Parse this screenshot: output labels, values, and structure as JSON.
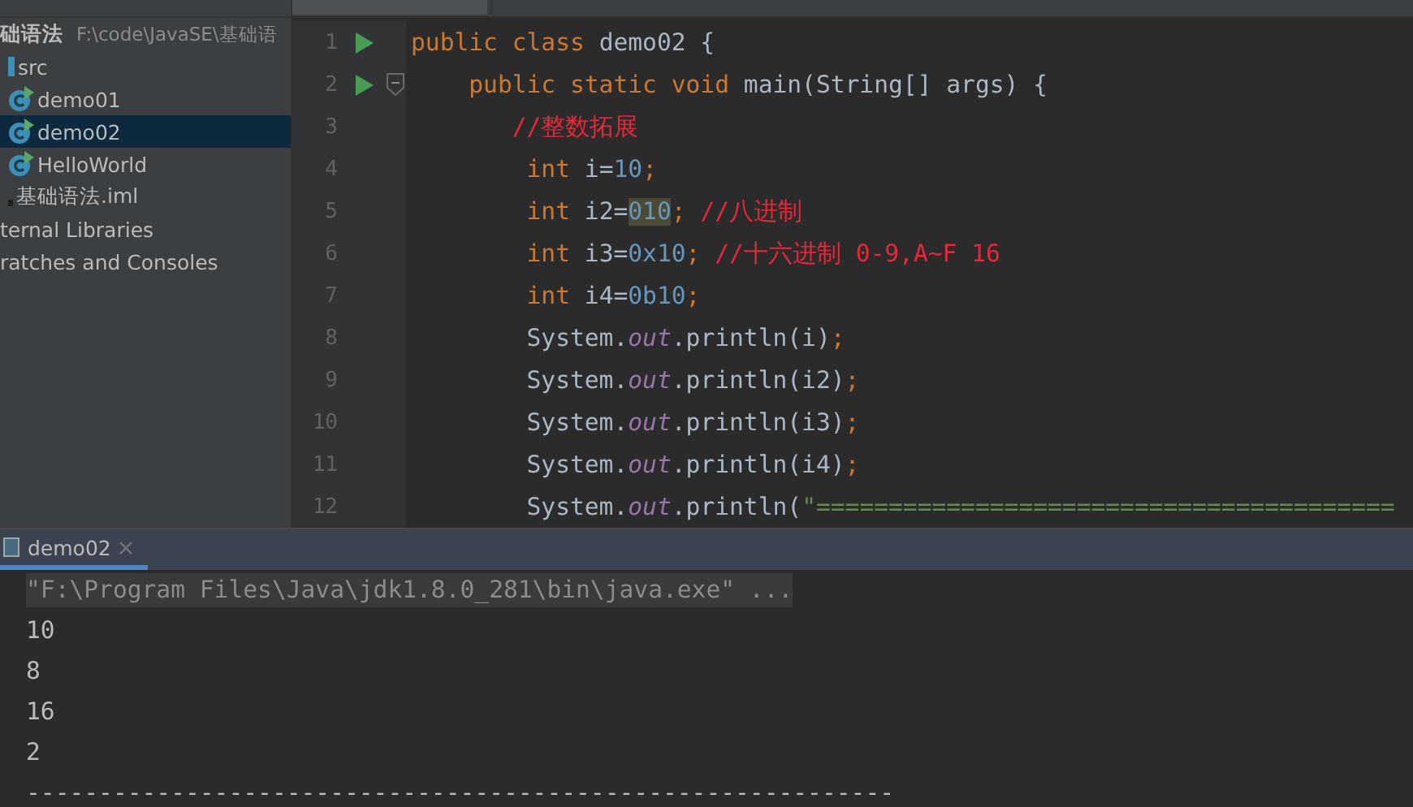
{
  "project_tree": {
    "items": [
      {
        "label": "础语法",
        "kind": "project",
        "path": "F:\\code\\JavaSE\\基础语",
        "selected": false,
        "children": [
          {
            "label": "src",
            "kind": "folder",
            "selected": false,
            "children": [
              {
                "label": "demo01",
                "kind": "class",
                "selected": false
              },
              {
                "label": "demo02",
                "kind": "class",
                "selected": true
              },
              {
                "label": "HelloWorld",
                "kind": "class",
                "selected": false
              }
            ]
          },
          {
            "label": "基础语法.iml",
            "kind": "file",
            "selected": false
          }
        ]
      },
      {
        "label": "ternal Libraries",
        "kind": "group",
        "selected": false
      },
      {
        "label": "ratches and Consoles",
        "kind": "group",
        "selected": false
      }
    ]
  },
  "editor": {
    "lines": [
      {
        "number": "1",
        "run": true,
        "fold": false,
        "tokens": [
          {
            "text": "public class ",
            "kind": "keyword"
          },
          {
            "text": "demo02 {",
            "kind": "plain"
          }
        ]
      },
      {
        "number": "2",
        "run": true,
        "fold": true,
        "tokens": [
          {
            "text": "    public static void ",
            "kind": "keyword"
          },
          {
            "text": "main(String[] args) {",
            "kind": "plain"
          }
        ]
      },
      {
        "number": "3",
        "run": false,
        "fold": false,
        "tokens": [
          {
            "text": "       //整数拓展",
            "kind": "comment"
          }
        ]
      },
      {
        "number": "4",
        "run": false,
        "fold": false,
        "tokens": [
          {
            "text": "        int ",
            "kind": "keyword"
          },
          {
            "text": "i=",
            "kind": "plain"
          },
          {
            "text": "10",
            "kind": "number"
          },
          {
            "text": ";",
            "kind": "keyword"
          }
        ]
      },
      {
        "number": "5",
        "run": false,
        "fold": false,
        "tokens": [
          {
            "text": "        int ",
            "kind": "keyword"
          },
          {
            "text": "i2=",
            "kind": "plain"
          },
          {
            "text": "010",
            "kind": "number",
            "highlighted": true
          },
          {
            "text": "; ",
            "kind": "keyword"
          },
          {
            "text": "//八进制",
            "kind": "comment"
          }
        ]
      },
      {
        "number": "6",
        "run": false,
        "fold": false,
        "tokens": [
          {
            "text": "        int ",
            "kind": "keyword"
          },
          {
            "text": "i3=",
            "kind": "plain"
          },
          {
            "text": "0x10",
            "kind": "number"
          },
          {
            "text": "; ",
            "kind": "keyword"
          },
          {
            "text": "//十六进制 0-9,A~F 16",
            "kind": "comment"
          }
        ]
      },
      {
        "number": "7",
        "run": false,
        "fold": false,
        "tokens": [
          {
            "text": "        int ",
            "kind": "keyword"
          },
          {
            "text": "i4=",
            "kind": "plain"
          },
          {
            "text": "0b10",
            "kind": "number"
          },
          {
            "text": ";",
            "kind": "keyword"
          }
        ]
      },
      {
        "number": "8",
        "run": false,
        "fold": false,
        "tokens": [
          {
            "text": "        System.",
            "kind": "plain"
          },
          {
            "text": "out",
            "kind": "field"
          },
          {
            "text": ".println(i)",
            "kind": "plain"
          },
          {
            "text": ";",
            "kind": "keyword"
          }
        ]
      },
      {
        "number": "9",
        "run": false,
        "fold": false,
        "tokens": [
          {
            "text": "        System.",
            "kind": "plain"
          },
          {
            "text": "out",
            "kind": "field"
          },
          {
            "text": ".println(i2)",
            "kind": "plain"
          },
          {
            "text": ";",
            "kind": "keyword"
          }
        ]
      },
      {
        "number": "10",
        "run": false,
        "fold": false,
        "tokens": [
          {
            "text": "        System.",
            "kind": "plain"
          },
          {
            "text": "out",
            "kind": "field"
          },
          {
            "text": ".println(i3)",
            "kind": "plain"
          },
          {
            "text": ";",
            "kind": "keyword"
          }
        ]
      },
      {
        "number": "11",
        "run": false,
        "fold": false,
        "tokens": [
          {
            "text": "        System.",
            "kind": "plain"
          },
          {
            "text": "out",
            "kind": "field"
          },
          {
            "text": ".println(i4)",
            "kind": "plain"
          },
          {
            "text": ";",
            "kind": "keyword"
          }
        ]
      },
      {
        "number": "12",
        "run": false,
        "fold": false,
        "tokens": [
          {
            "text": "        System.",
            "kind": "plain"
          },
          {
            "text": "out",
            "kind": "field"
          },
          {
            "text": ".println(",
            "kind": "plain"
          },
          {
            "text": "\"========================================",
            "kind": "string"
          }
        ]
      }
    ]
  },
  "run_panel": {
    "tabs": [
      {
        "label": "demo02",
        "selected": true
      }
    ],
    "output": [
      {
        "text": "\"F:\\Program Files\\Java\\jdk1.8.0_281\\bin\\java.exe\" ...",
        "kind": "command"
      },
      {
        "text": "10",
        "kind": "output"
      },
      {
        "text": "8",
        "kind": "output"
      },
      {
        "text": "16",
        "kind": "output"
      },
      {
        "text": "2",
        "kind": "output"
      },
      {
        "text": "------------------------------------------------------------",
        "kind": "output"
      }
    ]
  }
}
